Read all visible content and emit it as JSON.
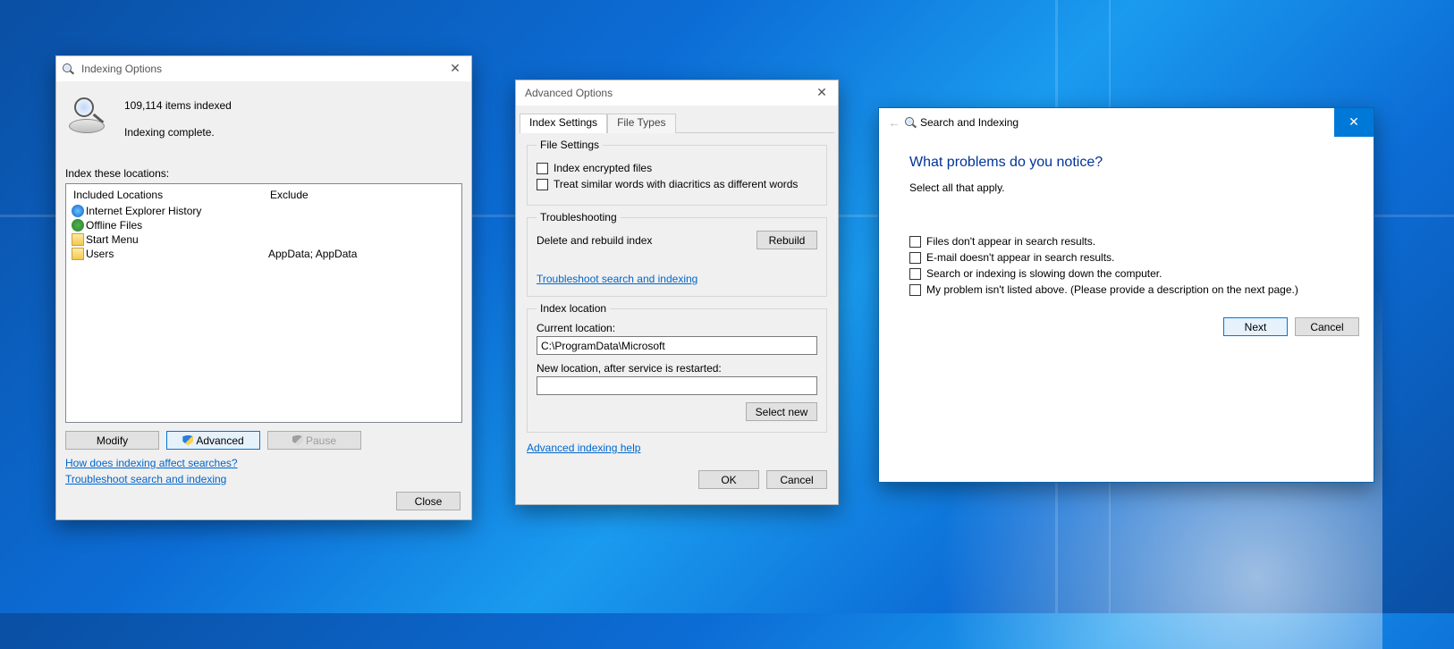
{
  "win1": {
    "title": "Indexing Options",
    "count_line": "109,114 items indexed",
    "status_line": "Indexing complete.",
    "locations_label": "Index these locations:",
    "hdr_included": "Included Locations",
    "hdr_exclude": "Exclude",
    "rows": [
      {
        "name": "Internet Explorer History",
        "exclude": ""
      },
      {
        "name": "Offline Files",
        "exclude": ""
      },
      {
        "name": "Start Menu",
        "exclude": ""
      },
      {
        "name": "Users",
        "exclude": "AppData; AppData"
      }
    ],
    "btn_modify": "Modify",
    "btn_advanced": "Advanced",
    "btn_pause": "Pause",
    "link1": "How does indexing affect searches?",
    "link2": "Troubleshoot search and indexing",
    "btn_close": "Close"
  },
  "win2": {
    "title": "Advanced Options",
    "tab1": "Index Settings",
    "tab2": "File Types",
    "fs_file_settings": "File Settings",
    "cb_encrypted": "Index encrypted files",
    "cb_diacritics": "Treat similar words with diacritics as different words",
    "fs_troubleshoot": "Troubleshooting",
    "rebuild_text": "Delete and rebuild index",
    "btn_rebuild": "Rebuild",
    "link_troubleshoot": "Troubleshoot search and indexing",
    "fs_index_loc": "Index location",
    "lbl_current": "Current location:",
    "current_value": "C:\\ProgramData\\Microsoft",
    "lbl_new": "New location, after service is restarted:",
    "btn_select_new": "Select new",
    "link_advhelp": "Advanced indexing help",
    "btn_ok": "OK",
    "btn_cancel": "Cancel"
  },
  "win3": {
    "title": "Search and Indexing",
    "heading": "What problems do you notice?",
    "subtext": "Select all that apply.",
    "opts": [
      "Files don't appear in search results.",
      "E-mail doesn't appear in search results.",
      "Search or indexing is slowing down the computer.",
      "My problem isn't listed above. (Please provide a description on the next page.)"
    ],
    "btn_next": "Next",
    "btn_cancel": "Cancel"
  }
}
